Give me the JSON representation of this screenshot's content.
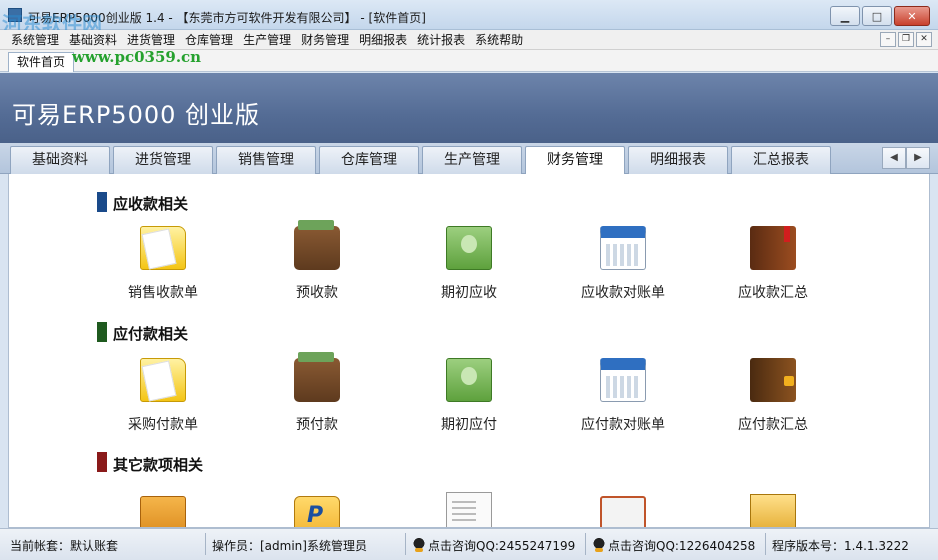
{
  "window": {
    "title": "可易ERP5000创业版 1.4 - 【东莞市方可软件开发有限公司】 - [软件首页]",
    "minimize": "▁",
    "maximize": "□",
    "close": "✕"
  },
  "menu": {
    "items": [
      "系统管理",
      "基础资料",
      "进货管理",
      "仓库管理",
      "生产管理",
      "财务管理",
      "明细报表",
      "统计报表",
      "系统帮助"
    ],
    "mdi_minimize": "–",
    "mdi_restore": "❐",
    "mdi_close": "✕"
  },
  "doc_tab": {
    "label": "软件首页"
  },
  "watermark": {
    "url": "www.pc0359.cn",
    "logo_text": "河东软件网"
  },
  "banner": {
    "title": "可易ERP5000 创业版"
  },
  "module_tabs": {
    "items": [
      "基础资料",
      "进货管理",
      "销售管理",
      "仓库管理",
      "生产管理",
      "财务管理",
      "明细报表",
      "汇总报表"
    ],
    "active_index": 5,
    "prev": "◀",
    "next": "▶"
  },
  "sections": [
    {
      "title": "应收款相关",
      "color": "#1a4a8a",
      "items": [
        {
          "label": "销售收款单",
          "icon": "folder-icon"
        },
        {
          "label": "预收款",
          "icon": "wallet-icon"
        },
        {
          "label": "期初应收",
          "icon": "money-icon"
        },
        {
          "label": "应收款对账单",
          "icon": "calendar-icon"
        },
        {
          "label": "应收款汇总",
          "icon": "book-icon"
        }
      ]
    },
    {
      "title": "应付款相关",
      "color": "#1f5a1f",
      "items": [
        {
          "label": "采购付款单",
          "icon": "folder-icon"
        },
        {
          "label": "预付款",
          "icon": "wallet-icon"
        },
        {
          "label": "期初应付",
          "icon": "money-icon"
        },
        {
          "label": "应付款对账单",
          "icon": "calendar-icon"
        },
        {
          "label": "应付款汇总",
          "icon": "book-icon"
        }
      ]
    },
    {
      "title": "其它款项相关",
      "color": "#8a1a1a",
      "items": [
        {
          "label": "",
          "icon": "folder-icon"
        },
        {
          "label": "",
          "icon": "paypal-icon"
        },
        {
          "label": "",
          "icon": "document-icon"
        },
        {
          "label": "",
          "icon": "clipboard-icon"
        },
        {
          "label": "",
          "icon": "box-icon"
        }
      ]
    }
  ],
  "status": {
    "account": "当前帐套：默认账套",
    "operator": "操作员：[admin]系统管理员",
    "qq1": "点击咨询QQ:2455247199",
    "qq2": "点击咨询QQ:1226404258",
    "version": "程序版本号：1.4.1.3222"
  }
}
